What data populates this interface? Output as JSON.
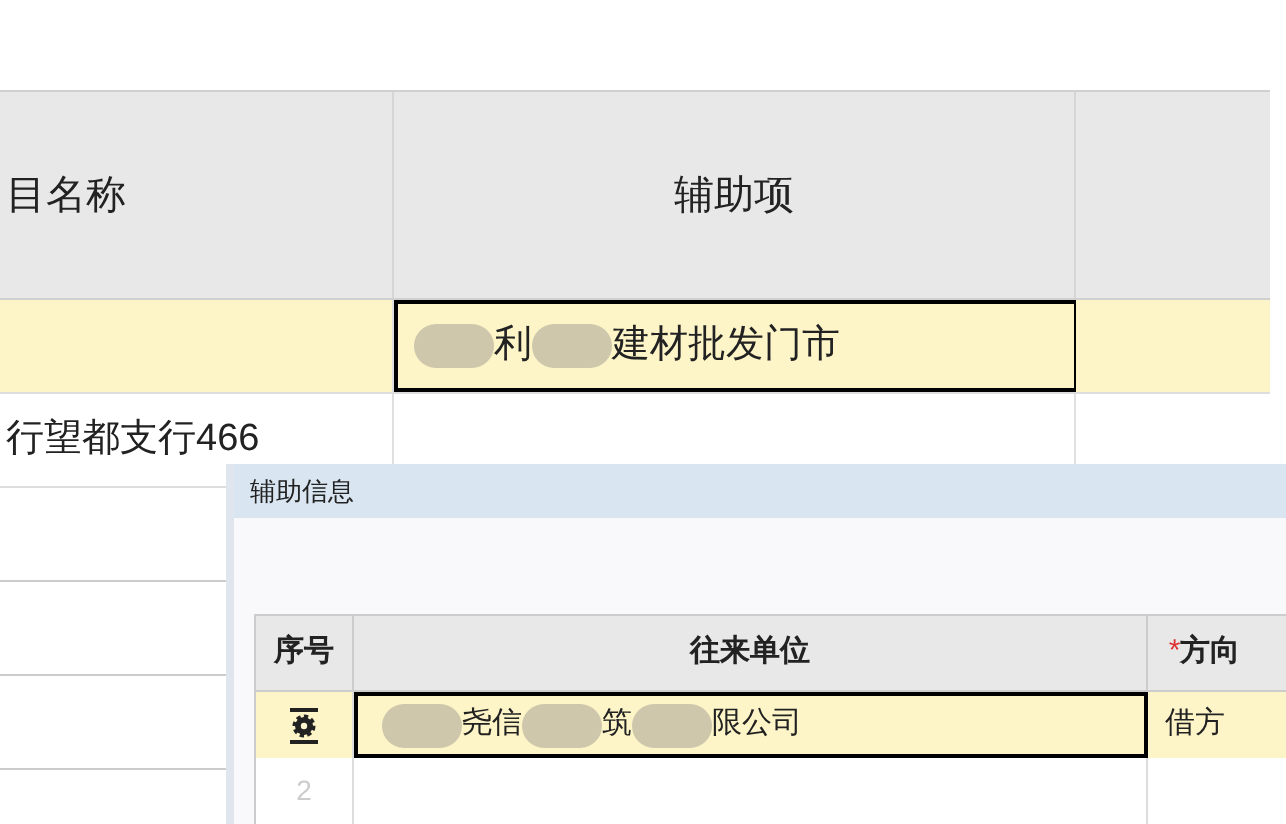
{
  "table": {
    "columns": [
      {
        "label": "目名称"
      },
      {
        "label": "辅助项"
      }
    ],
    "rows": [
      {
        "selected": true,
        "cells": [
          null,
          [
            {
              "kind": "blur"
            },
            {
              "kind": "text",
              "text": "利"
            },
            {
              "kind": "blur"
            },
            {
              "kind": "text",
              "text": "建材批发门市"
            }
          ]
        ]
      },
      {
        "selected": false,
        "cells": [
          "行望都支行466",
          null
        ]
      }
    ]
  },
  "dialog": {
    "title": "辅助信息",
    "table": {
      "columns": [
        {
          "label": "序号"
        },
        {
          "label": "往来单位"
        },
        {
          "label": "方向",
          "required_mark": "*"
        }
      ],
      "rows": [
        {
          "selected": true,
          "unit": [
            {
              "kind": "blur"
            },
            {
              "kind": "text",
              "text": "尧信"
            },
            {
              "kind": "blur"
            },
            {
              "kind": "text",
              "text": "筑"
            },
            {
              "kind": "blur"
            },
            {
              "kind": "text",
              "text": "限公司"
            }
          ],
          "direction": "借方"
        },
        {
          "selected": false,
          "index": "2"
        }
      ]
    }
  }
}
